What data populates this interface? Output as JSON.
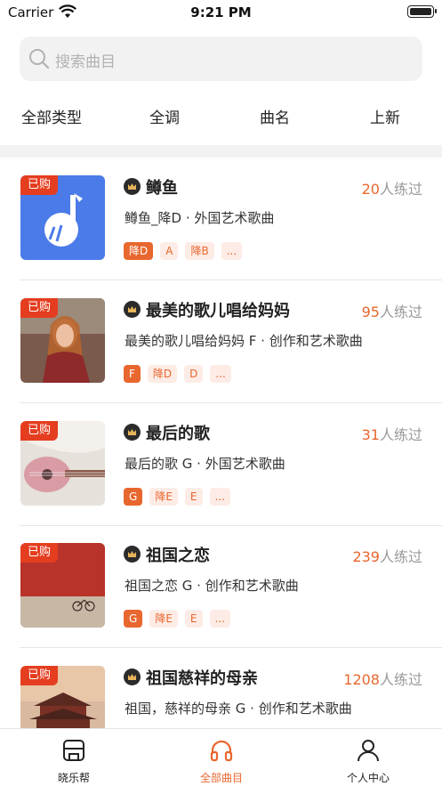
{
  "status_bar": {
    "carrier": "Carrier",
    "time": "9:21 PM"
  },
  "search": {
    "placeholder": "搜索曲目"
  },
  "filters": [
    "全部类型",
    "全调",
    "曲名",
    "上新"
  ],
  "songs": [
    {
      "badge": "已购",
      "title": "鳟鱼",
      "count": "20",
      "count_suffix": "人练过",
      "subtitle": "鳟鱼_降D · 外国艺术歌曲",
      "tags": [
        "降D",
        "A",
        "降B",
        "..."
      ]
    },
    {
      "badge": "已购",
      "title": "最美的歌儿唱给妈妈",
      "count": "95",
      "count_suffix": "人练过",
      "subtitle": "最美的歌儿唱给妈妈 F · 创作和艺术歌曲",
      "tags": [
        "F",
        "降D",
        "D",
        "..."
      ]
    },
    {
      "badge": "已购",
      "title": "最后的歌",
      "count": "31",
      "count_suffix": "人练过",
      "subtitle": "最后的歌 G · 外国艺术歌曲",
      "tags": [
        "G",
        "降E",
        "E",
        "..."
      ]
    },
    {
      "badge": "已购",
      "title": "祖国之恋",
      "count": "239",
      "count_suffix": "人练过",
      "subtitle": "祖国之恋 G · 创作和艺术歌曲",
      "tags": [
        "G",
        "降E",
        "E",
        "..."
      ]
    },
    {
      "badge": "已购",
      "title": "祖国慈祥的母亲",
      "count": "1208",
      "count_suffix": "人练过",
      "subtitle": "祖国，慈祥的母亲 G · 创作和艺术歌曲",
      "tags": []
    }
  ],
  "tabbar": [
    {
      "label": "晓乐帮",
      "icon": "shop-icon",
      "active": false
    },
    {
      "label": "全部曲目",
      "icon": "headphones-icon",
      "active": true
    },
    {
      "label": "个人中心",
      "icon": "person-icon",
      "active": false
    }
  ],
  "colors": {
    "accent": "#e8672e",
    "badge": "#e53d1f",
    "search_bg": "#f2f2f2"
  }
}
